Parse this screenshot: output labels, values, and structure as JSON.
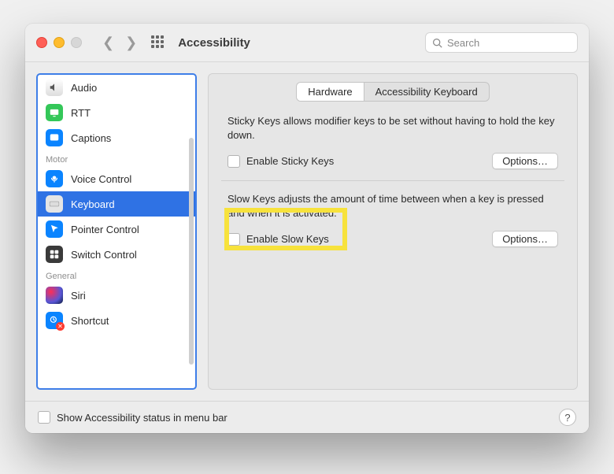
{
  "window": {
    "title": "Accessibility"
  },
  "search": {
    "placeholder": "Search"
  },
  "sidebar": {
    "groups": [
      {
        "label": "",
        "items": [
          {
            "label": "Audio"
          },
          {
            "label": "RTT"
          },
          {
            "label": "Captions"
          }
        ]
      },
      {
        "label": "Motor",
        "items": [
          {
            "label": "Voice Control"
          },
          {
            "label": "Keyboard",
            "selected": true
          },
          {
            "label": "Pointer Control"
          },
          {
            "label": "Switch Control"
          }
        ]
      },
      {
        "label": "General",
        "items": [
          {
            "label": "Siri"
          },
          {
            "label": "Shortcut"
          }
        ]
      }
    ]
  },
  "tabs": {
    "items": [
      {
        "label": "Hardware",
        "active": true
      },
      {
        "label": "Accessibility Keyboard",
        "active": false
      }
    ]
  },
  "panel": {
    "sticky": {
      "desc": "Sticky Keys allows modifier keys to be set without having to hold the key down.",
      "checkbox_label": "Enable Sticky Keys",
      "options_label": "Options…"
    },
    "slow": {
      "desc": "Slow Keys adjusts the amount of time between when a key is pressed and when it is activated.",
      "checkbox_label": "Enable Slow Keys",
      "options_label": "Options…"
    }
  },
  "footer": {
    "status_label": "Show Accessibility status in menu bar"
  }
}
